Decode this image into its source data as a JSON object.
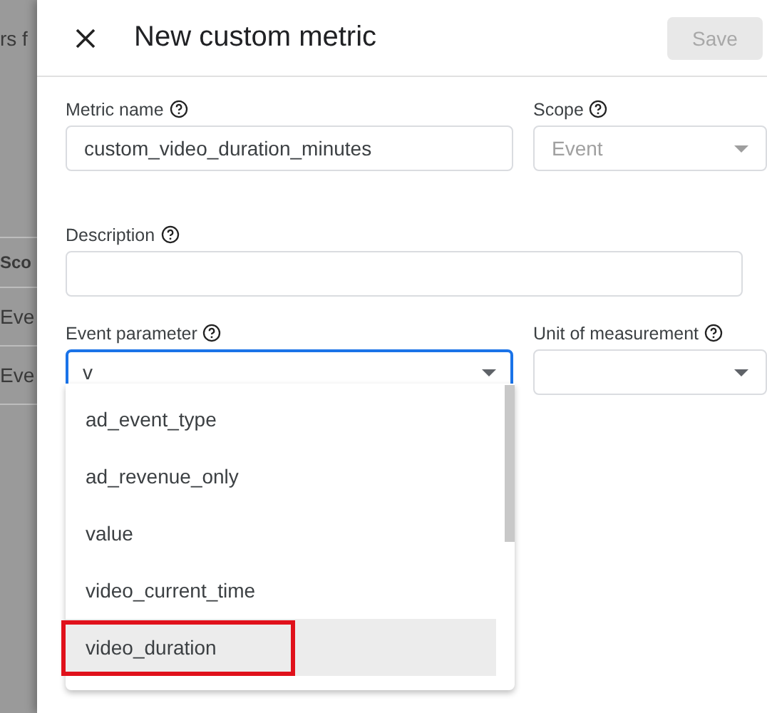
{
  "backdrop": {
    "texts": [
      {
        "kind": "title",
        "text": "rs f"
      },
      {
        "kind": "header",
        "text": "Sco"
      },
      {
        "kind": "cell",
        "text": "Eve"
      },
      {
        "kind": "cell",
        "text": "Eve"
      }
    ]
  },
  "panel": {
    "title": "New custom metric",
    "save_button": {
      "label": "Save",
      "disabled": true
    },
    "metric_name": {
      "label": "Metric name",
      "value": "custom_video_duration_minutes"
    },
    "scope": {
      "label": "Scope",
      "value": "Event",
      "disabled": true
    },
    "description": {
      "label": "Description"
    },
    "event_parameter": {
      "label": "Event parameter",
      "value": "v",
      "focused": true
    },
    "unit": {
      "label": "Unit of measurement"
    },
    "options": [
      {
        "label": "ad_event_type",
        "highlighted": false,
        "marked": false
      },
      {
        "label": "ad_revenue_only",
        "highlighted": false,
        "marked": false
      },
      {
        "label": "value",
        "highlighted": false,
        "marked": false
      },
      {
        "label": "video_current_time",
        "highlighted": false,
        "marked": false
      },
      {
        "label": "video_duration",
        "highlighted": true,
        "marked": true
      }
    ]
  }
}
